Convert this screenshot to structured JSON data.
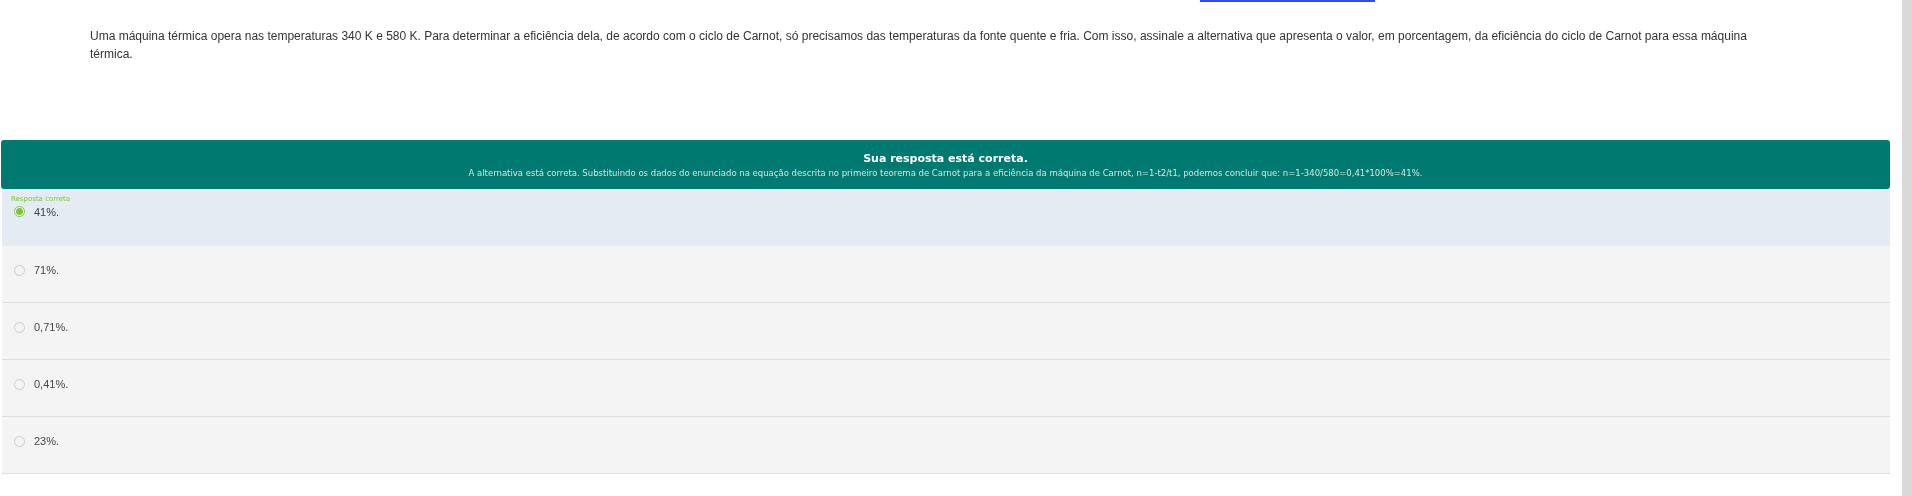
{
  "question": "Uma máquina térmica opera nas temperaturas 340 K e 580 K. Para determinar a eficiência dela, de acordo com o ciclo de Carnot, só precisamos das temperaturas da fonte quente e fria. Com isso, assinale a alternativa que apresenta o valor, em porcentagem, da eficiência do ciclo de Carnot para essa máquina térmica.",
  "feedback": {
    "title": "Sua resposta está correta.",
    "text": "A alternativa está correta. Substituindo os dados do enunciado na equação descrita no primeiro teorema de Carnot para a eficiência da máquina de Carnot, n=1-t2/t1, podemos concluir que: n=1-340/580=0,41*100%=41%."
  },
  "options": [
    {
      "label": "41%.",
      "selected": true,
      "tag": "Resposta correta"
    },
    {
      "label": "71%.",
      "selected": false
    },
    {
      "label": "0,71%.",
      "selected": false
    },
    {
      "label": "0,41%.",
      "selected": false
    },
    {
      "label": "23%.",
      "selected": false
    }
  ]
}
